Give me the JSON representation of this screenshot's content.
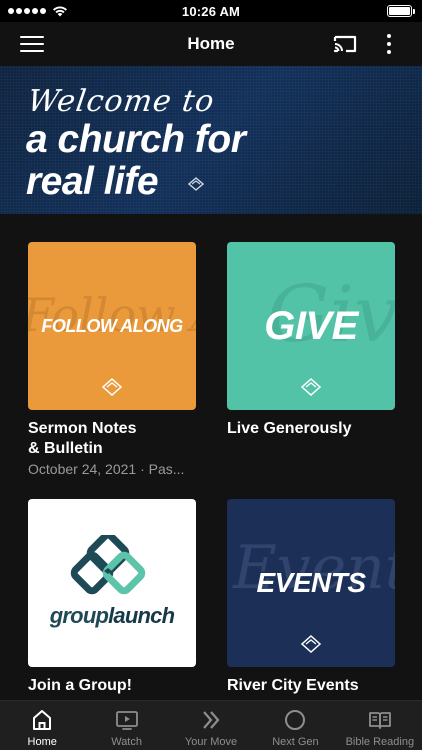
{
  "status_bar": {
    "time": "10:26 AM"
  },
  "header": {
    "title": "Home"
  },
  "hero": {
    "script_text": "Welcome to",
    "line1": "a church for",
    "line2": "real life"
  },
  "cards": [
    {
      "tile_text": "FOLLOW ALONG",
      "bg_script": "Follow Along",
      "title_line1": "Sermon Notes",
      "title_line2": "& Bulletin",
      "subtitle": "October 24, 2021 · Pas..."
    },
    {
      "tile_text": "GIVE",
      "bg_script": "Give",
      "title_line1": "Live Generously"
    },
    {
      "logo_word_a": "group",
      "logo_word_b": "launch",
      "title_line1": "Join a Group!"
    },
    {
      "tile_text": "EVENTS",
      "bg_script": "Events",
      "title_line1": "River City Events"
    }
  ],
  "tabs": [
    {
      "label": "Home",
      "icon": "home-icon",
      "active": true
    },
    {
      "label": "Watch",
      "icon": "tv-play-icon"
    },
    {
      "label": "Your Move",
      "icon": "double-chevron-icon"
    },
    {
      "label": "Next Gen",
      "icon": "circle-icon"
    },
    {
      "label": "Bible Reading",
      "icon": "open-book-icon"
    }
  ],
  "colors": {
    "background": "#121212",
    "hero_navy": "#12305a",
    "tile_orange": "#eb9a3b",
    "tile_teal": "#52c3a7",
    "tile_navy": "#1b2f57",
    "logo_dark_teal": "#1e4a57",
    "logo_light_teal": "#5cc4a8",
    "tab_bar": "#1f1f1f"
  }
}
